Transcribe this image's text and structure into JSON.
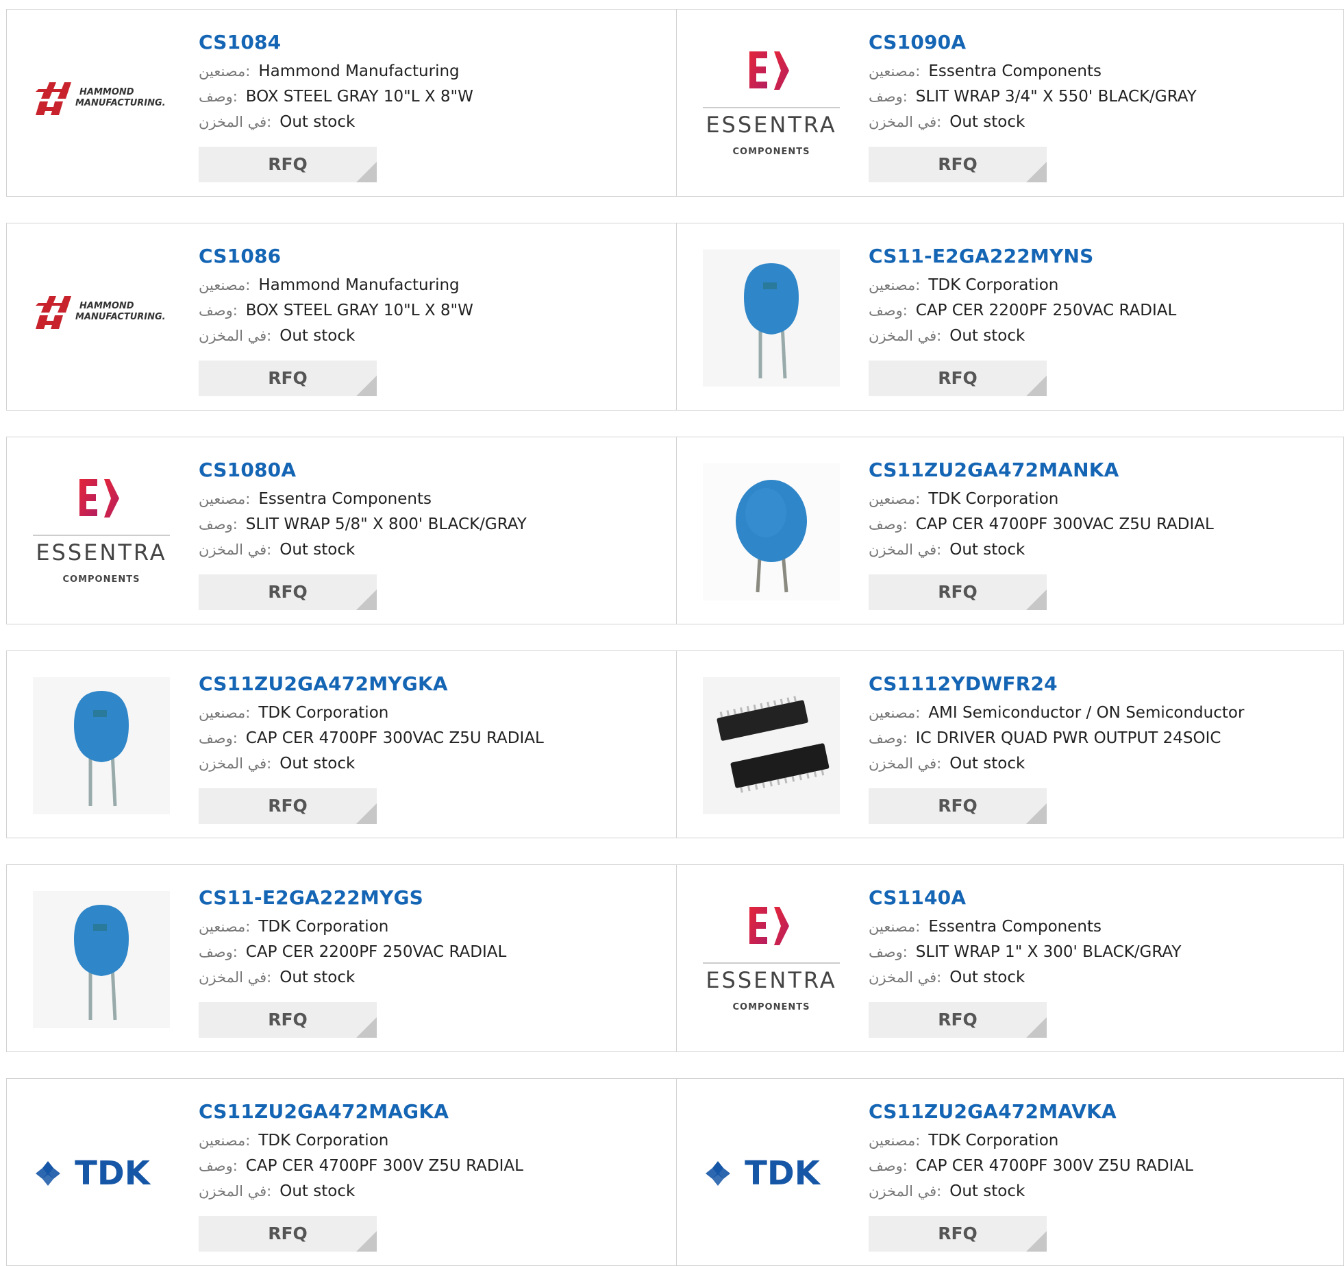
{
  "labels": {
    "manufacturer": "مصنعين",
    "description": "وصف",
    "stock": "في المخزن",
    "rfq": "RFQ"
  },
  "rows": [
    [
      {
        "part": "CS1084",
        "manufacturer": "Hammond Manufacturing",
        "description": "BOX STEEL GRAY 10\"L X 8\"W",
        "stock": "Out stock",
        "image": "hammond-logo"
      },
      {
        "part": "CS1090A",
        "manufacturer": "Essentra Components",
        "description": "SLIT WRAP 3/4\" X 550' BLACK/GRAY",
        "stock": "Out stock",
        "image": "essentra-logo"
      }
    ],
    [
      {
        "part": "CS1086",
        "manufacturer": "Hammond Manufacturing",
        "description": "BOX STEEL GRAY 10\"L X 8\"W",
        "stock": "Out stock",
        "image": "hammond-logo"
      },
      {
        "part": "CS11-E2GA222MYNS",
        "manufacturer": "TDK Corporation",
        "description": "CAP CER 2200PF 250VAC RADIAL",
        "stock": "Out stock",
        "image": "ceramic-capacitor-photo"
      }
    ],
    [
      {
        "part": "CS1080A",
        "manufacturer": "Essentra Components",
        "description": "SLIT WRAP 5/8\" X 800' BLACK/GRAY",
        "stock": "Out stock",
        "image": "essentra-logo"
      },
      {
        "part": "CS11ZU2GA472MANKA",
        "manufacturer": "TDK Corporation",
        "description": "CAP CER 4700PF 300VAC Z5U RADIAL",
        "stock": "Out stock",
        "image": "ceramic-capacitor-round-photo"
      }
    ],
    [
      {
        "part": "CS11ZU2GA472MYGKA",
        "manufacturer": "TDK Corporation",
        "description": "CAP CER 4700PF 300VAC Z5U RADIAL",
        "stock": "Out stock",
        "image": "ceramic-capacitor-photo"
      },
      {
        "part": "CS1112YDWFR24",
        "manufacturer": "AMI Semiconductor / ON Semiconductor",
        "description": "IC DRIVER QUAD PWR OUTPUT 24SOIC",
        "stock": "Out stock",
        "image": "soic-chip-photo"
      }
    ],
    [
      {
        "part": "CS11-E2GA222MYGS",
        "manufacturer": "TDK Corporation",
        "description": "CAP CER 2200PF 250VAC RADIAL",
        "stock": "Out stock",
        "image": "ceramic-capacitor-photo"
      },
      {
        "part": "CS1140A",
        "manufacturer": "Essentra Components",
        "description": "SLIT WRAP 1\" X 300' BLACK/GRAY",
        "stock": "Out stock",
        "image": "essentra-logo"
      }
    ],
    [
      {
        "part": "CS11ZU2GA472MAGKA",
        "manufacturer": "TDK Corporation",
        "description": "CAP CER 4700PF 300V Z5U RADIAL",
        "stock": "Out stock",
        "image": "tdk-logo"
      },
      {
        "part": "CS11ZU2GA472MAVKA",
        "manufacturer": "TDK Corporation",
        "description": "CAP CER 4700PF 300V Z5U RADIAL",
        "stock": "Out stock",
        "image": "tdk-logo"
      }
    ]
  ],
  "colors": {
    "part_link": "#1565b5",
    "border": "#d2d2d2",
    "rfq_bg": "#eeeeee",
    "essentra_red": "#e3263a",
    "hammond_red": "#c8232c",
    "tdk_blue": "#1656a6",
    "capacitor_blue": "#2f86c8"
  }
}
